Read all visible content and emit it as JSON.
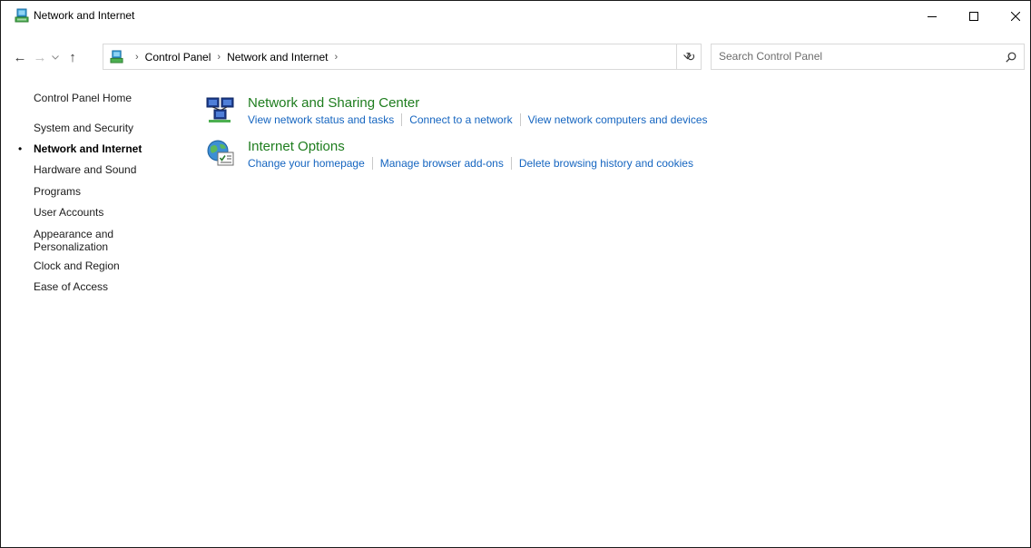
{
  "window": {
    "title": "Network and Internet"
  },
  "address": {
    "crumbs": [
      "Control Panel",
      "Network and Internet"
    ]
  },
  "search": {
    "placeholder": "Search Control Panel"
  },
  "sidebar": {
    "items": [
      {
        "label": "Control Panel Home"
      },
      {
        "label": "System and Security"
      },
      {
        "label": "Network and Internet",
        "active": true
      },
      {
        "label": "Hardware and Sound"
      },
      {
        "label": "Programs"
      },
      {
        "label": "User Accounts"
      },
      {
        "label": "Appearance and\nPersonalization"
      },
      {
        "label": "Clock and Region"
      },
      {
        "label": "Ease of Access"
      }
    ]
  },
  "main": {
    "categories": [
      {
        "title": "Network and Sharing Center",
        "icon": "network-sharing-icon",
        "links": [
          "View network status and tasks",
          "Connect to a network",
          "View network computers and devices"
        ]
      },
      {
        "title": "Internet Options",
        "icon": "internet-options-icon",
        "links": [
          "Change your homepage",
          "Manage browser add-ons",
          "Delete browsing history and cookies"
        ]
      }
    ]
  },
  "colors": {
    "category_title": "#1e7d1e",
    "link": "#1565c0"
  }
}
